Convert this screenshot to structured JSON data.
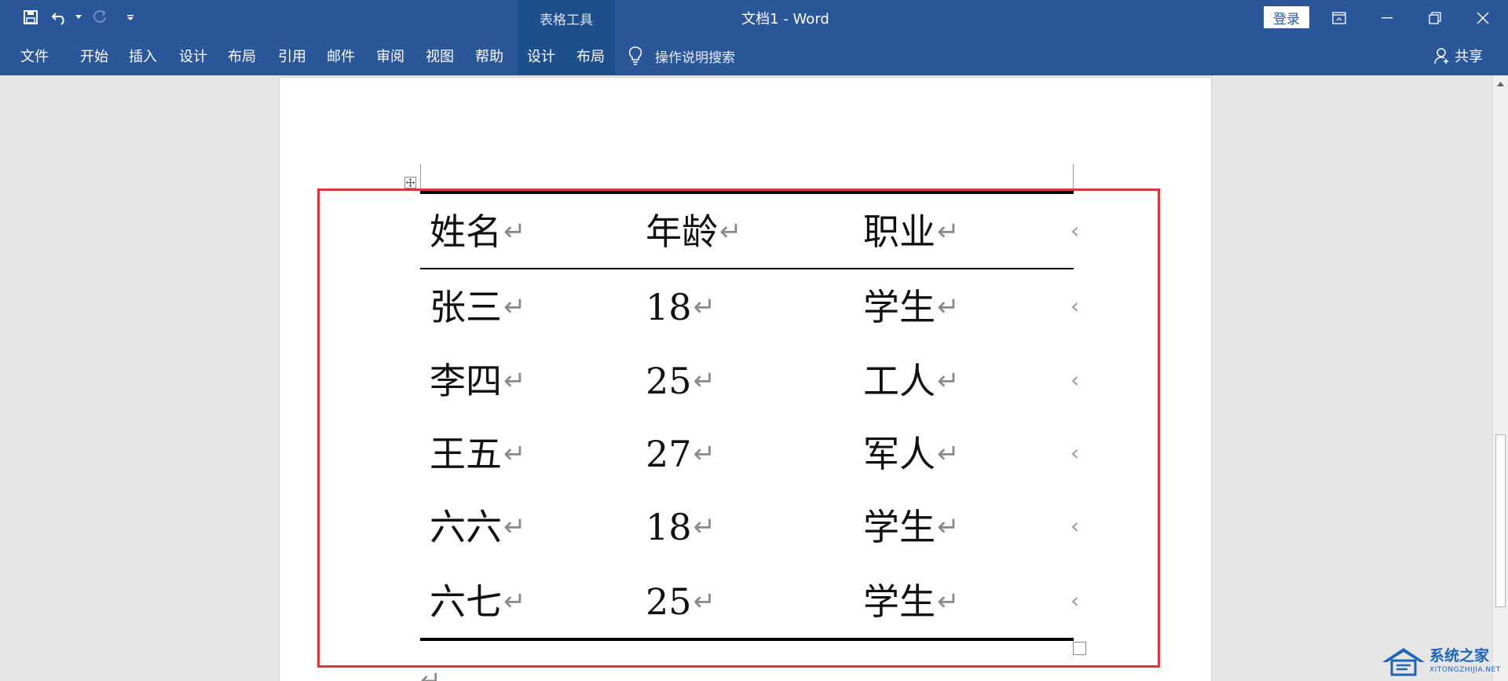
{
  "window": {
    "title": "文档1  -  Word",
    "contextual_header": "表格工具",
    "login_label": "登录"
  },
  "ribbon": {
    "tabs": [
      "文件",
      "开始",
      "插入",
      "设计",
      "布局",
      "引用",
      "邮件",
      "审阅",
      "视图",
      "帮助"
    ],
    "contextual_tabs": [
      "设计",
      "布局"
    ],
    "tell_me": "操作说明搜索",
    "share": "共享"
  },
  "table": {
    "headers": [
      "姓名",
      "年龄",
      "职业"
    ],
    "rows": [
      [
        "张三",
        "18",
        "学生"
      ],
      [
        "李四",
        "25",
        "工人"
      ],
      [
        "王五",
        "27",
        "军人"
      ],
      [
        "六六",
        "18",
        "学生"
      ],
      [
        "六七",
        "25",
        "学生"
      ]
    ]
  },
  "watermark": {
    "text": "系统之家",
    "sub": "XITONGZHIJIA.NET"
  },
  "colors": {
    "accent": "#2b579a",
    "contextual": "#1f4e8c",
    "highlight": "#d9363e"
  },
  "icons": [
    "save-icon",
    "undo-icon",
    "redo-icon",
    "customize-qat-icon",
    "ribbon-display-icon",
    "minimize-icon",
    "restore-icon",
    "close-icon",
    "lightbulb-icon",
    "person-icon"
  ]
}
